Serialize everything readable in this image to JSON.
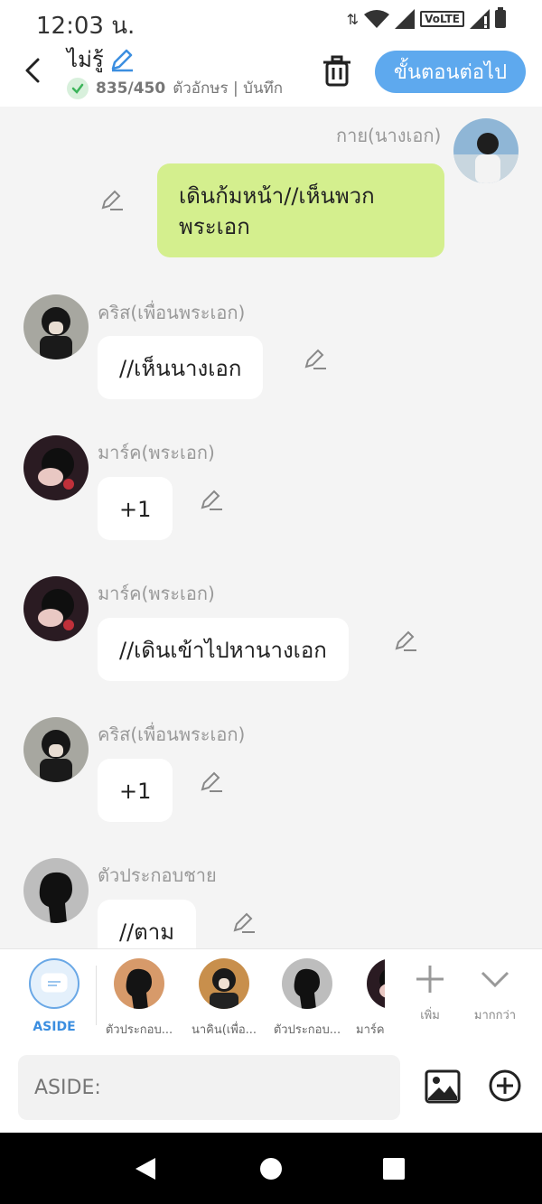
{
  "status": {
    "time": "12:03 น.",
    "volte": "VoLTE"
  },
  "header": {
    "title": "ไม่รู้",
    "char_count": "835/450",
    "meta": "ตัวอักษร | บันทึก",
    "next_label": "ขั้นตอนต่อไป"
  },
  "messages": [
    {
      "name": "กาย(นางเอก)",
      "text": "เดินก้มหน้า//เห็นพวก\nพระเอก",
      "side": "right"
    },
    {
      "name": "คริส(เพื่อนพระเอก)",
      "text": "//เห็นนางเอก",
      "side": "left"
    },
    {
      "name": "มาร์ค(พระเอก)",
      "text": "+1",
      "side": "left"
    },
    {
      "name": "มาร์ค(พระเอก)",
      "text": "//เดินเข้าไปหานางเอก",
      "side": "left"
    },
    {
      "name": "คริส(เพื่อนพระเอก)",
      "text": "+1",
      "side": "left"
    },
    {
      "name": "ตัวประกอบชาย",
      "text": "//ตาม",
      "side": "left"
    }
  ],
  "characters": [
    {
      "label": "ASIDE"
    },
    {
      "label": "ตัวประกอบ..."
    },
    {
      "label": "นาคิน(เพื่อ..."
    },
    {
      "label": "ตัวประกอบ..."
    },
    {
      "label": "มาร์ค"
    }
  ],
  "tools": {
    "add_label": "เพิ่ม",
    "more_label": "มากกว่า"
  },
  "input": {
    "placeholder": "ASIDE:"
  },
  "colors": {
    "accent": "#5ea9ee",
    "bubble_right": "#d4ef8e",
    "bg": "#f4f4f4"
  }
}
